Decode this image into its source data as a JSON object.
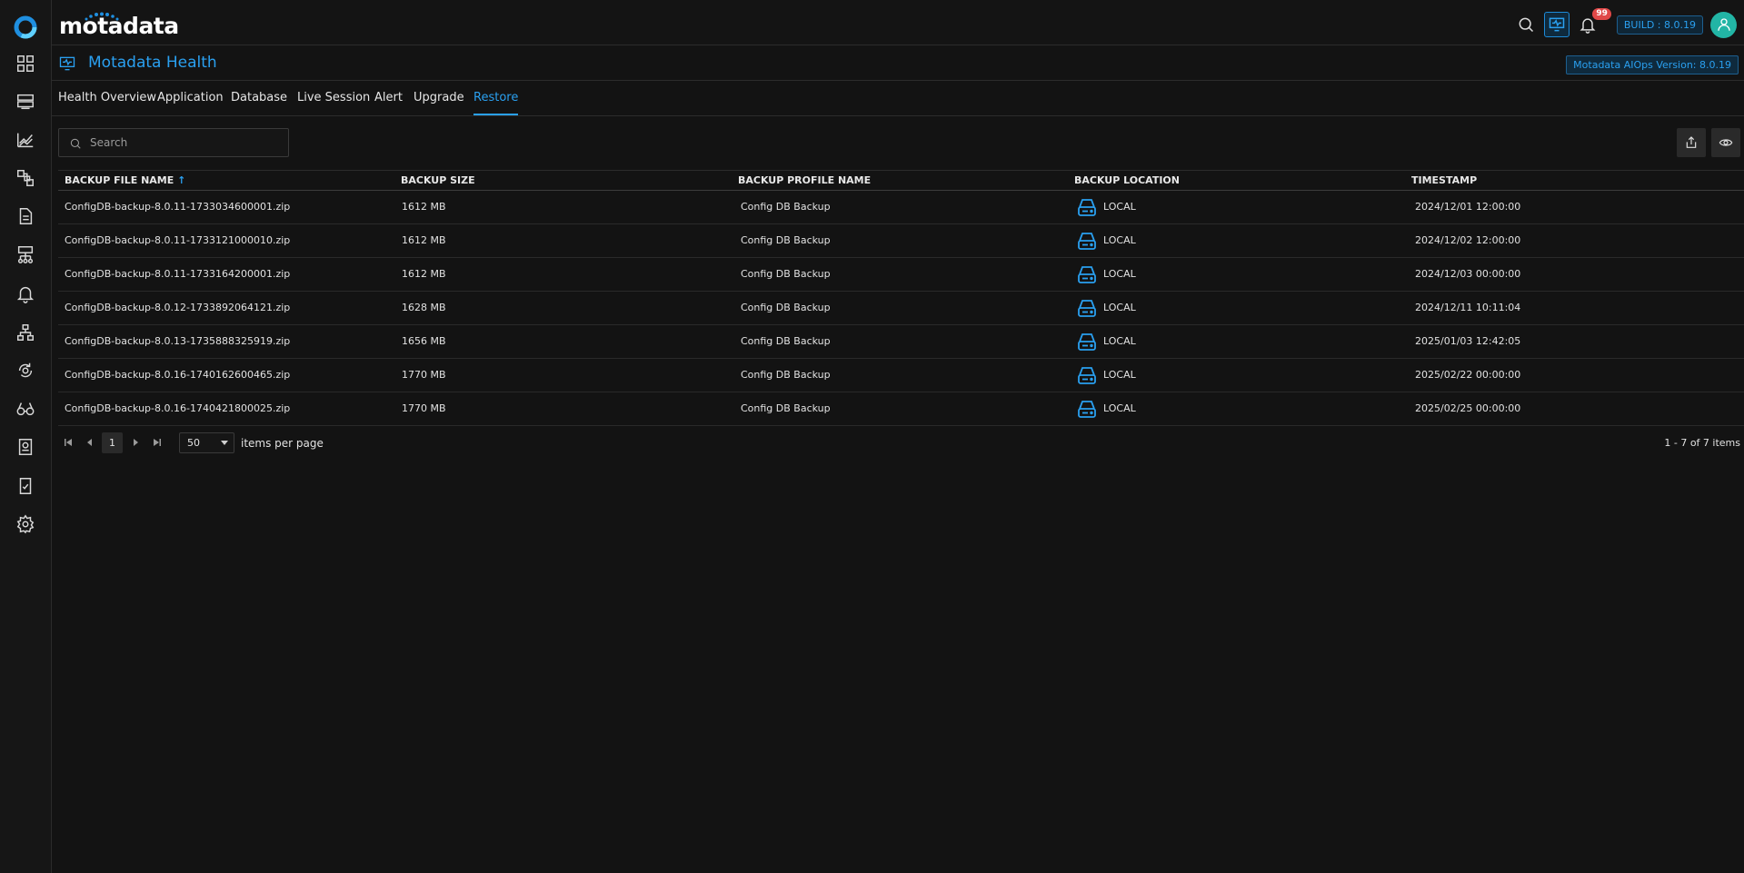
{
  "brand": {
    "name": "motadata"
  },
  "header": {
    "notification_count": "99",
    "build_label": "BUILD : 8.0.19"
  },
  "page": {
    "title": "Motadata Health",
    "version_label": "Motadata AIOps Version: 8.0.19"
  },
  "tabs": [
    {
      "label": "Health Overview"
    },
    {
      "label": "Application"
    },
    {
      "label": "Database"
    },
    {
      "label": "Live Session"
    },
    {
      "label": "Alert"
    },
    {
      "label": "Upgrade"
    },
    {
      "label": "Restore",
      "active": true
    }
  ],
  "search": {
    "placeholder": "Search",
    "value": ""
  },
  "table": {
    "columns": [
      "BACKUP FILE NAME",
      "BACKUP SIZE",
      "BACKUP PROFILE NAME",
      "BACKUP LOCATION",
      "TIMESTAMP"
    ],
    "sort_indicator": "↑",
    "rows": [
      {
        "file": "ConfigDB-backup-8.0.11-1733034600001.zip",
        "size": "1612 MB",
        "profile": "Config DB Backup",
        "location": "LOCAL",
        "timestamp": "2024/12/01 12:00:00"
      },
      {
        "file": "ConfigDB-backup-8.0.11-1733121000010.zip",
        "size": "1612 MB",
        "profile": "Config DB Backup",
        "location": "LOCAL",
        "timestamp": "2024/12/02 12:00:00"
      },
      {
        "file": "ConfigDB-backup-8.0.11-1733164200001.zip",
        "size": "1612 MB",
        "profile": "Config DB Backup",
        "location": "LOCAL",
        "timestamp": "2024/12/03 00:00:00"
      },
      {
        "file": "ConfigDB-backup-8.0.12-1733892064121.zip",
        "size": "1628 MB",
        "profile": "Config DB Backup",
        "location": "LOCAL",
        "timestamp": "2024/12/11 10:11:04"
      },
      {
        "file": "ConfigDB-backup-8.0.13-1735888325919.zip",
        "size": "1656 MB",
        "profile": "Config DB Backup",
        "location": "LOCAL",
        "timestamp": "2025/01/03 12:42:05"
      },
      {
        "file": "ConfigDB-backup-8.0.16-1740162600465.zip",
        "size": "1770 MB",
        "profile": "Config DB Backup",
        "location": "LOCAL",
        "timestamp": "2025/02/22 00:00:00"
      },
      {
        "file": "ConfigDB-backup-8.0.16-1740421800025.zip",
        "size": "1770 MB",
        "profile": "Config DB Backup",
        "location": "LOCAL",
        "timestamp": "2025/02/25 00:00:00"
      }
    ]
  },
  "pager": {
    "current_page": "1",
    "page_size": "50",
    "items_per_page_label": "items per page",
    "info": "1 - 7 of 7 items"
  },
  "icons": {
    "sidebar": [
      "dashboard-grid-icon",
      "server-icon",
      "metrics-chart-icon",
      "topology-icon",
      "report-icon",
      "network-icon",
      "alert-bell-icon",
      "hierarchy-icon",
      "monitor-cycle-icon",
      "binoculars-icon",
      "audit-icon",
      "compliance-icon",
      "settings-icon"
    ],
    "accent_color": "#2aa0f0"
  }
}
